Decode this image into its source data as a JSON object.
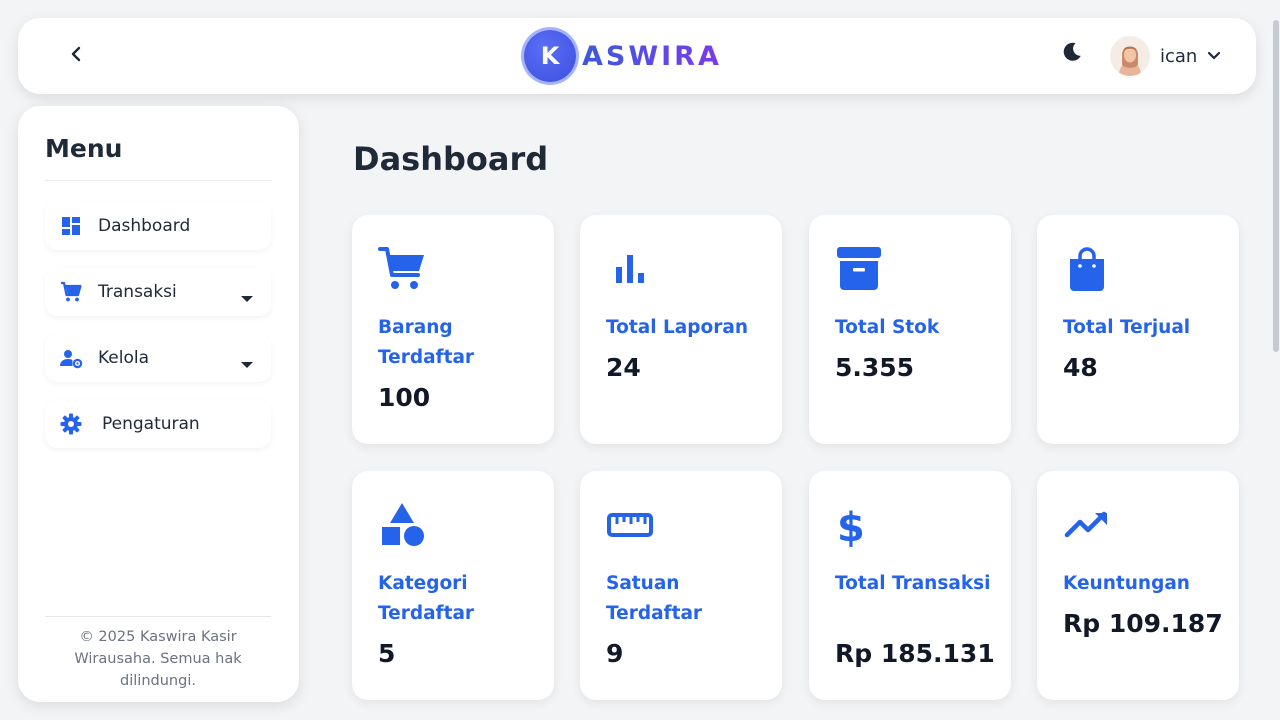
{
  "header": {
    "logo_letter": "K",
    "logo_text": "ASWIRA",
    "username": "ican",
    "icons": {
      "back": "chevron-left-icon",
      "theme": "moon-icon",
      "user_menu": "chevron-down-icon"
    }
  },
  "sidebar": {
    "title": "Menu",
    "items": [
      {
        "label": "Dashboard",
        "icon": "dashboard-icon",
        "has_caret": false
      },
      {
        "label": "Transaksi",
        "icon": "cart-icon",
        "has_caret": true
      },
      {
        "label": "Kelola",
        "icon": "users-cog-icon",
        "has_caret": true
      },
      {
        "label": "Pengaturan",
        "icon": "gear-icon",
        "has_caret": false
      }
    ],
    "footer": "© 2025 Kaswira Kasir Wirausaha. Semua hak dilindungi."
  },
  "main": {
    "title": "Dashboard",
    "cards": [
      {
        "label": "Barang Terdaftar",
        "value": "100",
        "icon": "shopping-cart-icon"
      },
      {
        "label": "Total Laporan",
        "value": "24",
        "icon": "bar-chart-icon"
      },
      {
        "label": "Total Stok",
        "value": "5.355",
        "icon": "archive-box-icon"
      },
      {
        "label": "Total Terjual",
        "value": "48",
        "icon": "shopping-bag-icon"
      },
      {
        "label": "Kategori Terdaftar",
        "value": "5",
        "icon": "shapes-icon"
      },
      {
        "label": "Satuan Terdaftar",
        "value": "9",
        "icon": "ruler-icon"
      },
      {
        "label": "Total Transaksi",
        "value": "Rp 185.131",
        "icon": "dollar-icon"
      },
      {
        "label": "Keuntungan",
        "value": "Rp 109.187",
        "icon": "trending-up-icon"
      }
    ]
  },
  "colors": {
    "accent": "#2563eb",
    "background": "#f3f4f6",
    "text": "#1f2937"
  }
}
